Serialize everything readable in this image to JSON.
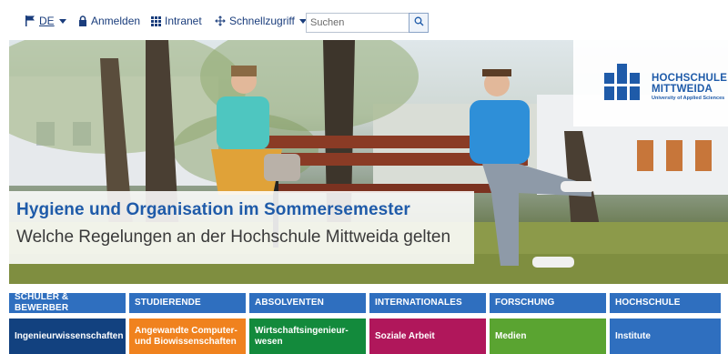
{
  "topbar": {
    "language": "DE",
    "login_label": "Anmelden",
    "intranet_label": "Intranet",
    "quickaccess_label": "Schnellzugriff",
    "search_placeholder": "Suchen"
  },
  "hero": {
    "title": "Hygiene und Organisation im Sommersemester",
    "subtitle": "Welche Regelungen an der Hochschule Mittweida gelten"
  },
  "logo": {
    "line1": "HOCHSCHULE",
    "line2": "MITTWEIDA",
    "tagline": "University of Applied Sciences"
  },
  "categories": [
    {
      "label": "SCHÜLER & BEWERBER"
    },
    {
      "label": "STUDIERENDE"
    },
    {
      "label": "ABSOLVENTEN"
    },
    {
      "label": "INTERNATIONALES"
    },
    {
      "label": "FORSCHUNG"
    },
    {
      "label": "HOCHSCHULE"
    }
  ],
  "faculties": [
    {
      "label": "Ingenieurwissenschaften",
      "color": "#12417f"
    },
    {
      "label": "Angewandte Computer- und Biowissenschaften",
      "color": "#f0821e"
    },
    {
      "label": "Wirtschaftsingenieur-wesen",
      "color": "#138a3c"
    },
    {
      "label": "Soziale Arbeit",
      "color": "#b0175b"
    },
    {
      "label": "Medien",
      "color": "#5aa431"
    },
    {
      "label": "Institute",
      "color": "#2f6fbf"
    }
  ],
  "colors": {
    "brand_blue": "#1f5ba9",
    "category_blue": "#2f6fbf"
  }
}
